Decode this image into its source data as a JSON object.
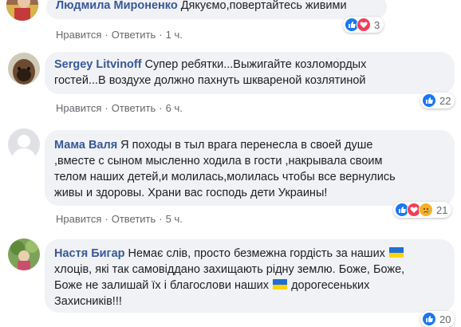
{
  "colors": {
    "author": "#385898",
    "bubble": "#f0f2f5",
    "like": "#1877f2",
    "love": "#f33e58",
    "sad": "#f7b125",
    "ukraine_blue": "#1f6fd6",
    "ukraine_yellow": "#ffd500"
  },
  "comments": [
    {
      "author": "Людмила Мироненко",
      "lines": [
        "Дякуємо,повертайтесь живими"
      ],
      "like_label": "Нравится",
      "reply_label": "Ответить",
      "time": "1 ч.",
      "reactions": [
        "like-icon",
        "love-icon"
      ],
      "reaction_count": "3"
    },
    {
      "author": "Sergey Litvinoff",
      "lines": [
        "Супер ребятки...Выжигайте козломордых",
        "гостей...В воздухе должно пахнуть шквареной козлятиной"
      ],
      "like_label": "Нравится",
      "reply_label": "Ответить",
      "time": "6 ч.",
      "reactions": [
        "like-icon"
      ],
      "reaction_count": "22"
    },
    {
      "author": "Мама Валя",
      "lines": [
        "Я походы в тыл врага перенесла в своей душе",
        ",вместе с сыном мысленно ходила в гости ,накрывала своим",
        "телом наших детей,и молилась,молилась чтобы все вернулись",
        "живы и здоровы. Храни вас господь дети Украины!"
      ],
      "like_label": "Нравится",
      "reply_label": "Ответить",
      "time": "5 ч.",
      "reactions": [
        "like-icon",
        "love-icon",
        "sad-icon"
      ],
      "reaction_count": "21"
    },
    {
      "author": "Настя Бигар",
      "line1": "Немає слів, просто безмежна гордість за наших",
      "line2": "хлоців, які так самовiддано захищають рідну землю. Боже, Боже,",
      "line3a": "Боже не залишай їх і благослови наших",
      "line3b": "дорогесеньких",
      "line4": "Захисників!!!",
      "reactions": [
        "like-icon"
      ],
      "reaction_count": "20"
    }
  ]
}
